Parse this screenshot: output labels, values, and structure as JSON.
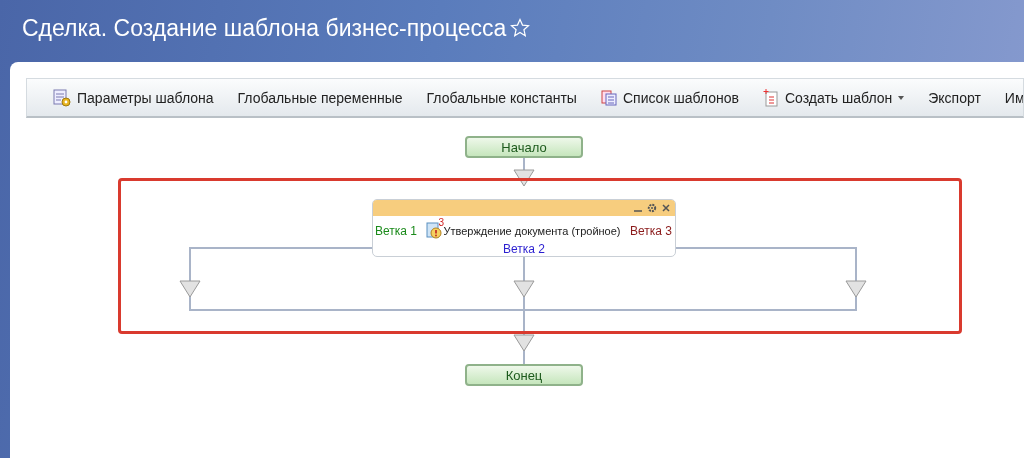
{
  "page": {
    "title": "Сделка. Создание шаблона бизнес-процесса"
  },
  "toolbar": [
    {
      "label": "Параметры шаблона",
      "kind": "settings",
      "has_menu": false
    },
    {
      "label": "Глобальные переменные",
      "kind": "plain",
      "has_menu": false
    },
    {
      "label": "Глобальные константы",
      "kind": "plain",
      "has_menu": false
    },
    {
      "label": "Список шаблонов",
      "kind": "list",
      "has_menu": false
    },
    {
      "label": "Создать шаблон",
      "kind": "new",
      "has_menu": true
    },
    {
      "label": "Экспорт",
      "kind": "plain",
      "has_menu": false
    },
    {
      "label": "Им",
      "kind": "plain",
      "has_menu": false
    }
  ],
  "diagram": {
    "start": "Начало",
    "end": "Конец",
    "highlighted": true,
    "activity": {
      "label": "Утверждение документа (тройное)",
      "badge": "3",
      "branches": [
        {
          "label": "Ветка 1",
          "color": "#1a8a1a"
        },
        {
          "label": "Ветка 2",
          "color": "#2b1fd0"
        },
        {
          "label": "Ветка 3",
          "color": "#8b1a1a"
        }
      ]
    }
  }
}
